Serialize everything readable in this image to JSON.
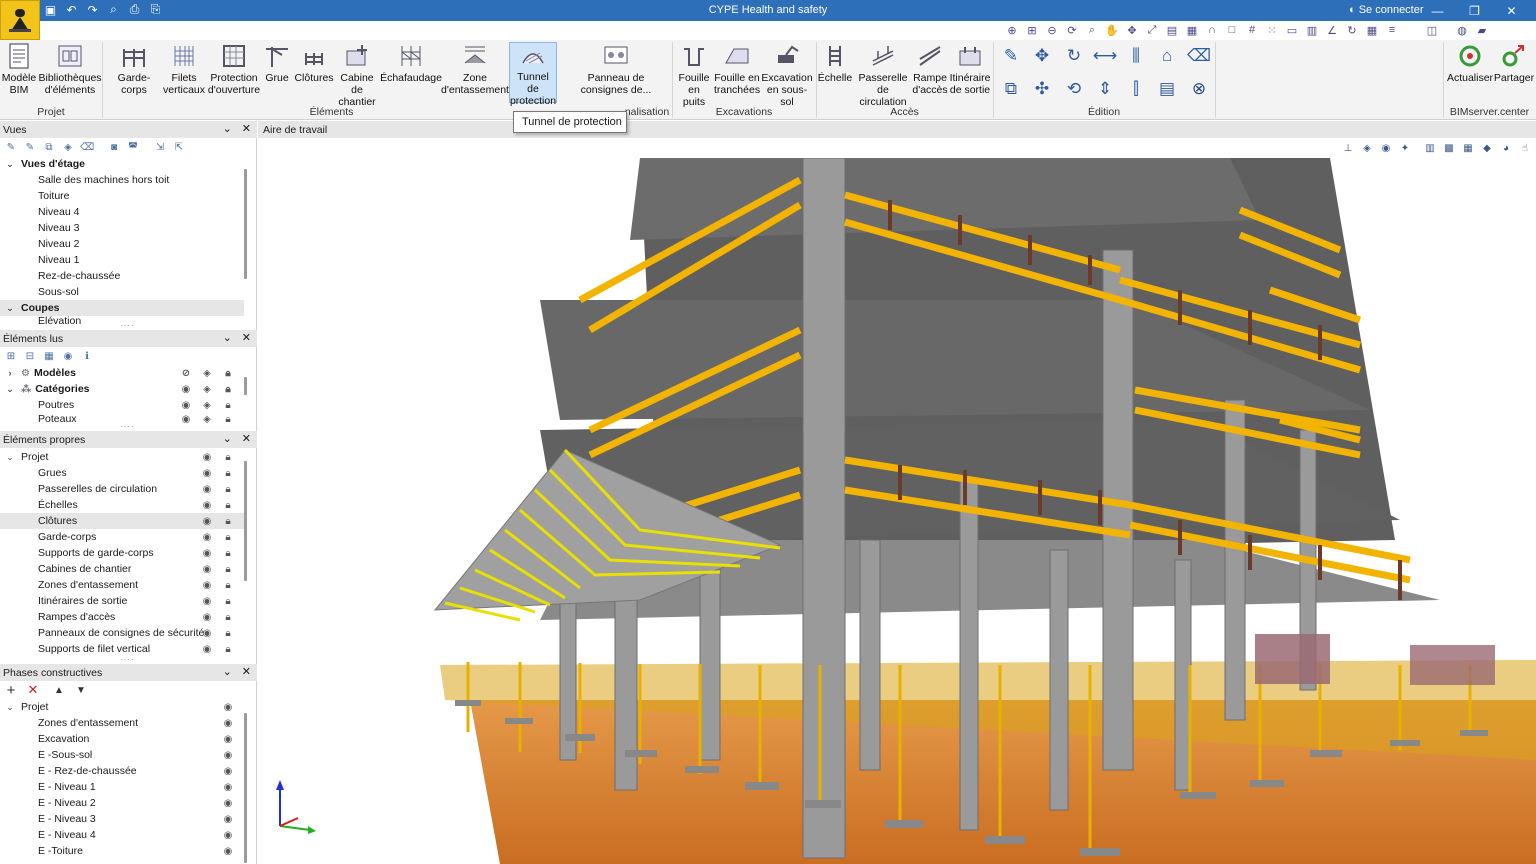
{
  "app": {
    "title": "CYPE Health and safety",
    "login_label": "Se connecter"
  },
  "window": {
    "minimize": "—",
    "restore": "❐",
    "close": "✕"
  },
  "quick_access": [
    "save-icon",
    "undo-icon",
    "redo-icon",
    "search-icon",
    "print-icon",
    "print-preview-icon"
  ],
  "ribbon": {
    "projet": {
      "group_label": "Projet",
      "modele_bim": "Modèle BIM",
      "bibliotheques": "Bibliothèques d'éléments"
    },
    "elements": {
      "group_label": "Éléments",
      "garde_corps": "Garde-corps",
      "filets_verticaux": "Filets verticaux",
      "protection_ouverture": "Protection d'ouverture",
      "grue": "Grue",
      "clotures": "Clôtures",
      "cabine_chantier": "Cabine de chantier",
      "echafaudage": "Échafaudage",
      "zone_entassement": "Zone d'entassement",
      "tunnel_protection": "Tunnel de protection",
      "panneau_consignes": "Panneau de consignes de...",
      "signalisation_partial": "nalisation"
    },
    "excavations": {
      "group_label": "Excavations",
      "fouille_puits": "Fouille en puits",
      "fouille_tranchees": "Fouille en tranchées",
      "excavation_sous_sol": "Excavation en sous-sol"
    },
    "acces": {
      "group_label": "Accès",
      "echelle": "Échelle",
      "passerelle": "Passerelle de circulation",
      "rampe": "Rampe d'accès",
      "itineraire": "Itinéraire de sortie"
    },
    "edition": {
      "group_label": "Édition"
    },
    "bimserver": {
      "group_label": "BIMserver.center",
      "actualiser": "Actualiser",
      "partager": "Partager"
    }
  },
  "tooltip": "Tunnel de protection",
  "panels": {
    "vues": {
      "title": "Vues",
      "floor_views_label": "Vues d'étage",
      "floor_views": [
        "Salle des machines hors toit",
        "Toiture",
        "Niveau 4",
        "Niveau 3",
        "Niveau 2",
        "Niveau 1",
        "Rez-de-chaussée",
        "Sous-sol"
      ],
      "sections_label": "Coupes",
      "sections": [
        "Élévation"
      ]
    },
    "elements_lus": {
      "title": "Éléments lus",
      "modeles": "Modèles",
      "categories": "Catégories",
      "items": [
        "Poutres",
        "Poteaux"
      ]
    },
    "elements_propres": {
      "title": "Éléments propres",
      "root": "Projet",
      "items": [
        "Grues",
        "Passerelles de circulation",
        "Échelles",
        "Clôtures",
        "Garde-corps",
        "Supports de garde-corps",
        "Cabines de chantier",
        "Zones d'entassement",
        "Itinéraires de sortie",
        "Rampes d'accès",
        "Panneaux de consignes de sécurité",
        "Supports de filet vertical"
      ],
      "selected": "Clôtures"
    },
    "phases": {
      "title": "Phases constructives",
      "root": "Projet",
      "items": [
        "Zones d'entassement",
        "Excavation",
        "E -Sous-sol",
        "E - Rez-de-chaussée",
        "E - Niveau 1",
        "E - Niveau 2",
        "E - Niveau 3",
        "E - Niveau 4",
        "E -Toiture"
      ]
    }
  },
  "workspace": {
    "title": "Aire de travail"
  },
  "colors": {
    "titlebar": "#2d6fb8",
    "accent_yellow": "#f0b400",
    "concrete": "#8e8e8e",
    "slab_dark": "#5c5c5c",
    "ground_orange": "#e08a3c"
  }
}
